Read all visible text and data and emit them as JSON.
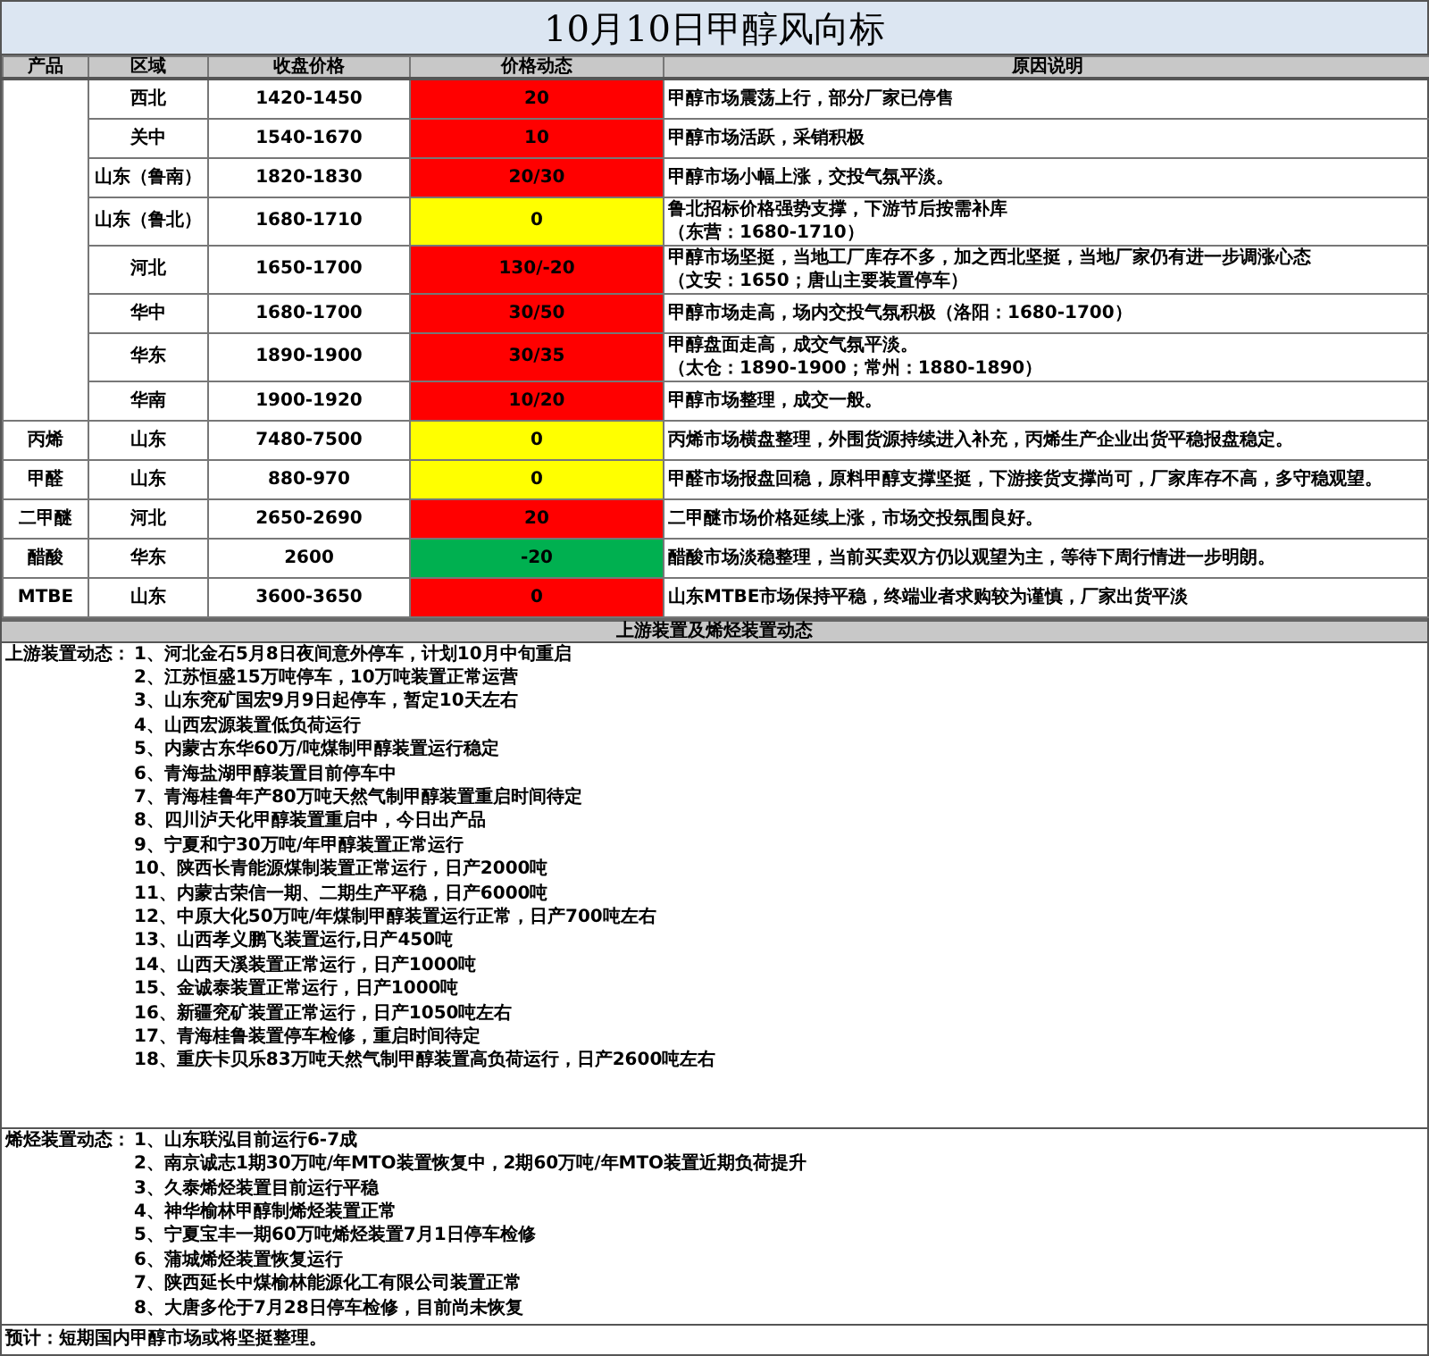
{
  "title": "10月10日甲醇风向标",
  "columns": [
    "产品",
    "区域",
    "收盘价格",
    "价格动态",
    "原因说明"
  ],
  "groups": [
    {
      "rows": [
        {
          "region": "西北",
          "price": "1420-1450",
          "change": "20",
          "color": "#ff0000",
          "reason": [
            "甲醇市场震荡上行，部分厂家已停售"
          ]
        },
        {
          "region": "关中",
          "price": "1540-1670",
          "change": "10",
          "color": "#ff0000",
          "reason": [
            "甲醇市场活跃，采销积极"
          ]
        },
        {
          "region": "山东（鲁南）",
          "price": "1820-1830",
          "change": "20/30",
          "color": "#ff0000",
          "reason": [
            "甲醇市场小幅上涨，交投气氛平淡。"
          ]
        },
        {
          "region": "山东（鲁北）",
          "price": "1680-1710",
          "change": "0",
          "color": "#ffff00",
          "reason": [
            "鲁北招标价格强势支撑，下游节后按需补库",
            "（东营：1680-1710）"
          ]
        },
        {
          "region": "河北",
          "price": "1650-1700",
          "change": "130/-20",
          "color": "#ff0000",
          "reason": [
            "甲醇市场坚挺，当地工厂库存不多，加之西北坚挺，当地厂家仍有进一步调涨心态",
            "（文安：1650；唐山主要装置停车）"
          ]
        },
        {
          "region": "华中",
          "price": "1680-1700",
          "change": "30/50",
          "color": "#ff0000",
          "reason": [
            "甲醇市场走高，场内交投气氛积极（洛阳：1680-1700）"
          ]
        },
        {
          "region": "华东",
          "price": "1890-1900",
          "change": "30/35",
          "color": "#ff0000",
          "reason": [
            "甲醇盘面走高，成交气氛平淡。",
            "（太仓：1890-1900；常州：1880-1890）"
          ]
        },
        {
          "region": "华南",
          "price": "1900-1920",
          "change": "10/20",
          "color": "#ff0000",
          "reason": [
            "甲醇市场整理，成交一般。"
          ]
        }
      ]
    },
    {
      "product": "丙烯",
      "rows": [
        {
          "region": "山东",
          "price": "7480-7500",
          "change": "0",
          "color": "#ffff00",
          "reason": [
            "丙烯市场横盘整理，外围货源持续进入补充，丙烯生产企业出货平稳报盘稳定。"
          ]
        }
      ]
    },
    {
      "product": "甲醛",
      "rows": [
        {
          "region": "山东",
          "price": "880-970",
          "change": "0",
          "color": "#ffff00",
          "reason": [
            "甲醛市场报盘回稳，原料甲醇支撑坚挺，下游接货支撑尚可，厂家库存不高，多守稳观望。"
          ]
        }
      ]
    },
    {
      "product": "二甲醚",
      "rows": [
        {
          "region": "河北",
          "price": "2650-2690",
          "change": "20",
          "color": "#ff0000",
          "reason": [
            "二甲醚市场价格延续上涨，市场交投氛围良好。"
          ]
        }
      ]
    },
    {
      "product": "醋酸",
      "rows": [
        {
          "region": "华东",
          "price": "2600",
          "change": "-20",
          "color": "#00b050",
          "reason": [
            "醋酸市场淡稳整理，当前买卖双方仍以观望为主，等待下周行情进一步明朗。"
          ]
        }
      ]
    },
    {
      "product": "MTBE",
      "rows": [
        {
          "region": "山东",
          "price": "3600-3650",
          "change": "0",
          "color": "#ff0000",
          "reason": [
            "山东MTBE市场保持平稳，终端业者求购较为谨慎，厂家出货平淡"
          ]
        }
      ]
    }
  ],
  "section_title": "上游装置及烯烃装置动态",
  "sections": [
    {
      "label": "上游装置动态：",
      "items": [
        "1、河北金石5月8日夜间意外停车，计划10月中旬重启",
        "2、江苏恒盛15万吨停车，10万吨装置正常运营",
        "3、山东兖矿国宏9月9日起停车，暂定10天左右",
        "4、山西宏源装置低负荷运行",
        "5、内蒙古东华60万/吨煤制甲醇装置运行稳定",
        "6、青海盐湖甲醇装置目前停车中",
        "7、青海桂鲁年产80万吨天然气制甲醇装置重启时间待定",
        "8、四川泸天化甲醇装置重启中，今日出产品",
        "9、宁夏和宁30万吨/年甲醇装置正常运行",
        "10、陕西长青能源煤制装置正常运行，日产2000吨",
        "11、内蒙古荣信一期、二期生产平稳，日产6000吨",
        "12、中原大化50万吨/年煤制甲醇装置运行正常，日产700吨左右",
        "13、山西孝义鹏飞装置运行,日产450吨",
        "14、山西天溪装置正常运行，日产1000吨",
        "15、金诚泰装置正常运行，日产1000吨",
        "16、新疆兖矿装置正常运行，日产1050吨左右",
        "17、青海桂鲁装置停车检修，重启时间待定",
        "18、重庆卡贝乐83万吨天然气制甲醇装置高负荷运行，日产2600吨左右"
      ]
    },
    {
      "label": "烯烃装置动态：",
      "items": [
        "1、山东联泓目前运行6-7成",
        "2、南京诚志1期30万吨/年MTO装置恢复中，2期60万吨/年MTO装置近期负荷提升",
        "3、久泰烯烃装置目前运行平稳",
        "4、神华榆林甲醇制烯烃装置正常",
        "5、宁夏宝丰一期60万吨烯烃装置7月1日停车检修",
        "6、蒲城烯烃装置恢复运行",
        "7、陕西延长中煤榆林能源化工有限公司装置正常",
        "8、大唐多伦于7月28日停车检修，目前尚未恢复"
      ]
    }
  ],
  "forecast": "预计：短期国内甲醇市场或将坚挺整理。"
}
